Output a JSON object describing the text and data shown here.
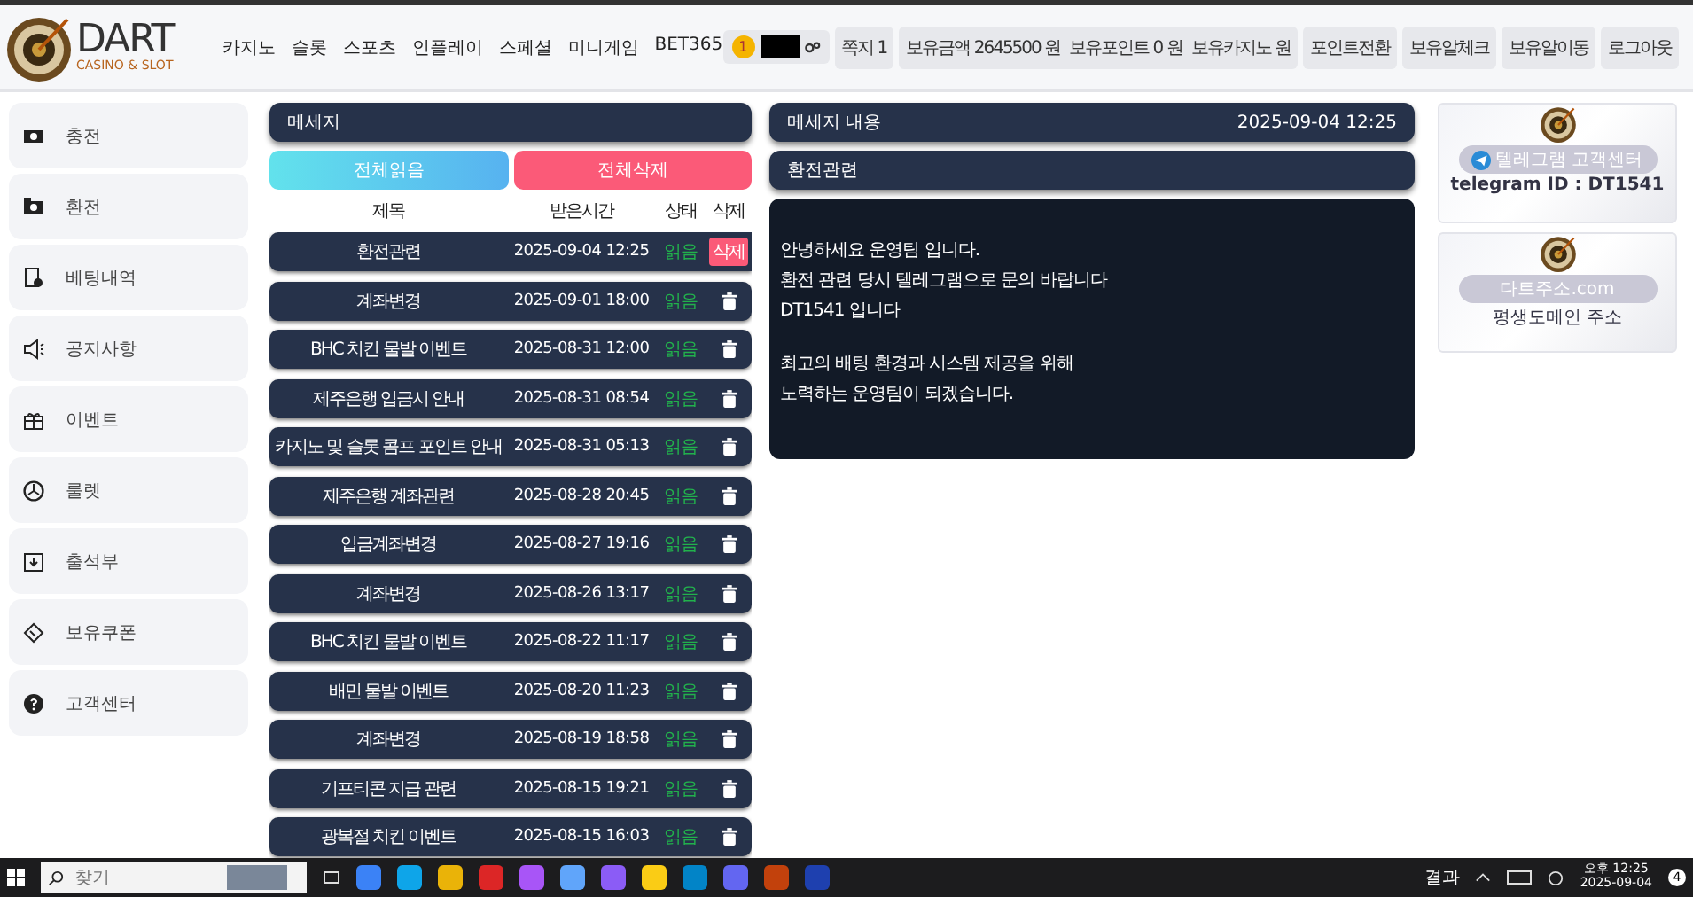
{
  "header": {
    "logo": {
      "title": "DART",
      "subtitle": "CASINO & SLOT"
    },
    "nav": [
      "카지노",
      "슬롯",
      "스포츠",
      "인플레이",
      "스페셜",
      "미니게임",
      "BET365"
    ],
    "user": {
      "level": "1"
    },
    "messages_button": "쪽지 1",
    "wallet": [
      "보유금액 2645500 원",
      "보유포인트 0 원",
      "보유카지노 원"
    ],
    "actions": [
      "포인트전환",
      "보유알체크",
      "보유알이동",
      "로그아웃"
    ]
  },
  "sidebar": {
    "items": [
      {
        "label": "충전",
        "kind": "cash"
      },
      {
        "label": "환전",
        "kind": "exchange"
      },
      {
        "label": "베팅내역",
        "kind": "receipt"
      },
      {
        "label": "공지사항",
        "kind": "megaphone"
      },
      {
        "label": "이벤트",
        "kind": "gift"
      },
      {
        "label": "룰렛",
        "kind": "roulette"
      },
      {
        "label": "출석부",
        "kind": "calendar"
      },
      {
        "label": "보유쿠폰",
        "kind": "coupon"
      },
      {
        "label": "고객센터",
        "kind": "help"
      }
    ]
  },
  "messages": {
    "title": "메세지",
    "read_all": "전체읽음",
    "delete_all": "전체삭제",
    "columns": [
      "제목",
      "받은시간",
      "상태",
      "삭제"
    ],
    "rows": [
      {
        "title": "환전관련",
        "time": "2025-09-04 12:25",
        "status": "읽음",
        "selected": true,
        "delete_label": "삭제"
      },
      {
        "title": "계좌변경",
        "time": "2025-09-01 18:00",
        "status": "읽음",
        "selected": false
      },
      {
        "title": "BHC 치킨 물발 이벤트",
        "time": "2025-08-31 12:00",
        "status": "읽음",
        "selected": false
      },
      {
        "title": "제주은행 입금시 안내",
        "time": "2025-08-31 08:54",
        "status": "읽음",
        "selected": false
      },
      {
        "title": "카지노 및 슬롯 콤프 포인트 안내",
        "time": "2025-08-31 05:13",
        "status": "읽음",
        "selected": false
      },
      {
        "title": "제주은행 계좌관련",
        "time": "2025-08-28 20:45",
        "status": "읽음",
        "selected": false
      },
      {
        "title": "입금계좌변경",
        "time": "2025-08-27 19:16",
        "status": "읽음",
        "selected": false
      },
      {
        "title": "계좌변경",
        "time": "2025-08-26 13:17",
        "status": "읽음",
        "selected": false
      },
      {
        "title": "BHC 치킨 물발 이벤트",
        "time": "2025-08-22 11:17",
        "status": "읽음",
        "selected": false
      },
      {
        "title": "배민 물발 이벤트",
        "time": "2025-08-20 11:23",
        "status": "읽음",
        "selected": false
      },
      {
        "title": "계좌변경",
        "time": "2025-08-19 18:58",
        "status": "읽음",
        "selected": false
      },
      {
        "title": "기프티콘 지급 관련",
        "time": "2025-08-15 19:21",
        "status": "읽음",
        "selected": false
      },
      {
        "title": "광복절 치킨 이벤트",
        "time": "2025-08-15 16:03",
        "status": "읽음",
        "selected": false
      }
    ]
  },
  "detail": {
    "title": "메세지 내용",
    "time": "2025-09-04 12:25",
    "subject": "환전관련",
    "paragraphs": [
      [
        "안녕하세요 운영팀 입니다.",
        "환전 관련 당시 텔레그램으로 문의 바랍니다",
        "DT1541 입니다"
      ],
      [
        "최고의 배팅 환경과 시스템 제공을 위해",
        "노력하는 운영팀이 되겠습니다."
      ]
    ]
  },
  "banners": [
    {
      "kind": "telegram",
      "label": "텔레그램 고객센터",
      "caption": "telegram ID : DT1541"
    },
    {
      "kind": "domain",
      "label": "다트주소.com",
      "caption": "평생도메인 주소"
    }
  ],
  "taskbar": {
    "search_placeholder": "찾기",
    "widget": "결과",
    "time": "오후 12:25",
    "date": "2025-09-04",
    "notifications": "4"
  }
}
